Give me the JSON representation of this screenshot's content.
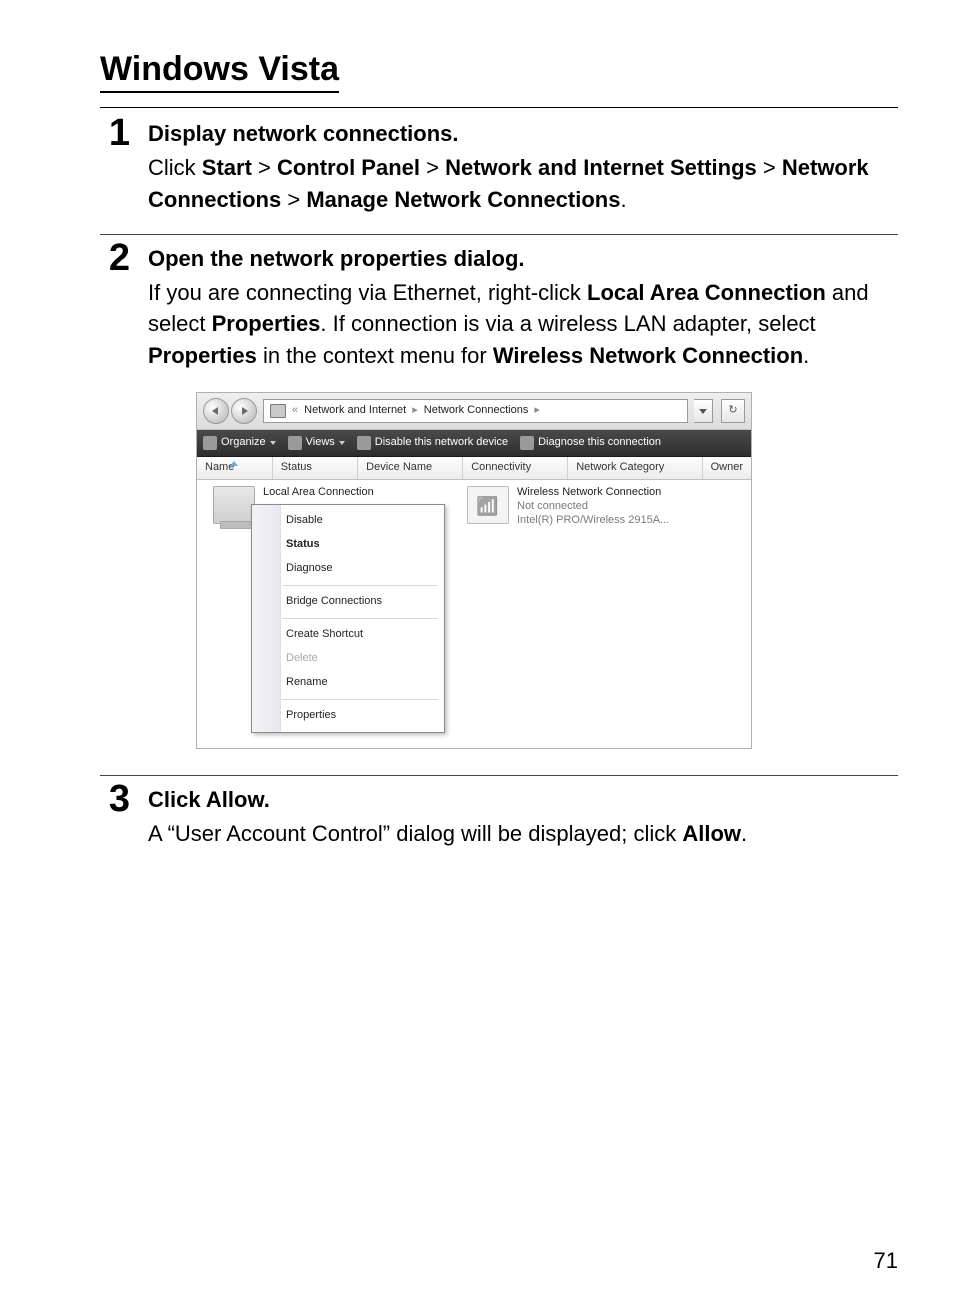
{
  "title": "Windows Vista",
  "page_number": "71",
  "steps": [
    {
      "num": "1",
      "heading": "Display network connections.",
      "text_parts": [
        {
          "t": "Click ",
          "b": false
        },
        {
          "t": "Start",
          "b": true
        },
        {
          "t": " > ",
          "b": false
        },
        {
          "t": "Control Panel",
          "b": true
        },
        {
          "t": " > ",
          "b": false
        },
        {
          "t": "Network and Internet Settings",
          "b": true
        },
        {
          "t": " > ",
          "b": false
        },
        {
          "t": "Network Connections",
          "b": true
        },
        {
          "t": " > ",
          "b": false
        },
        {
          "t": "Manage Network Connections",
          "b": true
        },
        {
          "t": ".",
          "b": false
        }
      ]
    },
    {
      "num": "2",
      "heading": "Open the network properties dialog.",
      "text_parts": [
        {
          "t": "If you are connecting via Ethernet, right-click ",
          "b": false
        },
        {
          "t": "Local Area Connection",
          "b": true
        },
        {
          "t": " and select ",
          "b": false
        },
        {
          "t": "Properties",
          "b": true
        },
        {
          "t": ". If connection is via a wireless LAN adapter, select ",
          "b": false
        },
        {
          "t": "Properties",
          "b": true
        },
        {
          "t": " in the context menu for ",
          "b": false
        },
        {
          "t": "Wireless Network Connection",
          "b": true
        },
        {
          "t": ".",
          "b": false
        }
      ]
    },
    {
      "num": "3",
      "heading_parts": [
        {
          "t": "Click ",
          "b": false
        },
        {
          "t": "Allow",
          "b": true
        },
        {
          "t": ".",
          "b": false
        }
      ],
      "text_parts": [
        {
          "t": "A “User Account Control” dialog will be displayed; click ",
          "b": false
        },
        {
          "t": "Allow",
          "b": true
        },
        {
          "t": ".",
          "b": false
        }
      ]
    }
  ],
  "screenshot": {
    "breadcrumb": {
      "quo": "«",
      "seg1": "Network and Internet",
      "seg2": "Network Connections"
    },
    "toolbar": {
      "organize": "Organize",
      "views": "Views",
      "disable": "Disable this network device",
      "diagnose": "Diagnose this connection"
    },
    "columns": {
      "name": "Name",
      "status": "Status",
      "device": "Device Name",
      "connectivity": "Connectivity",
      "category": "Network Category",
      "owner": "Owner"
    },
    "local": {
      "title": "Local Area Connection"
    },
    "wlan": {
      "title": "Wireless Network Connection",
      "status": "Not connected",
      "device": "Intel(R) PRO/Wireless 2915A..."
    },
    "context_menu": [
      {
        "label": "Disable",
        "bold": false,
        "disabled": false
      },
      {
        "label": "Status",
        "bold": true,
        "disabled": false
      },
      {
        "label": "Diagnose",
        "bold": false,
        "disabled": false
      },
      {
        "sep": true
      },
      {
        "label": "Bridge Connections",
        "bold": false,
        "disabled": false
      },
      {
        "sep": true
      },
      {
        "label": "Create Shortcut",
        "bold": false,
        "disabled": false
      },
      {
        "label": "Delete",
        "bold": false,
        "disabled": true
      },
      {
        "label": "Rename",
        "bold": false,
        "disabled": false
      },
      {
        "sep": true
      },
      {
        "label": "Properties",
        "bold": false,
        "disabled": false
      }
    ]
  }
}
